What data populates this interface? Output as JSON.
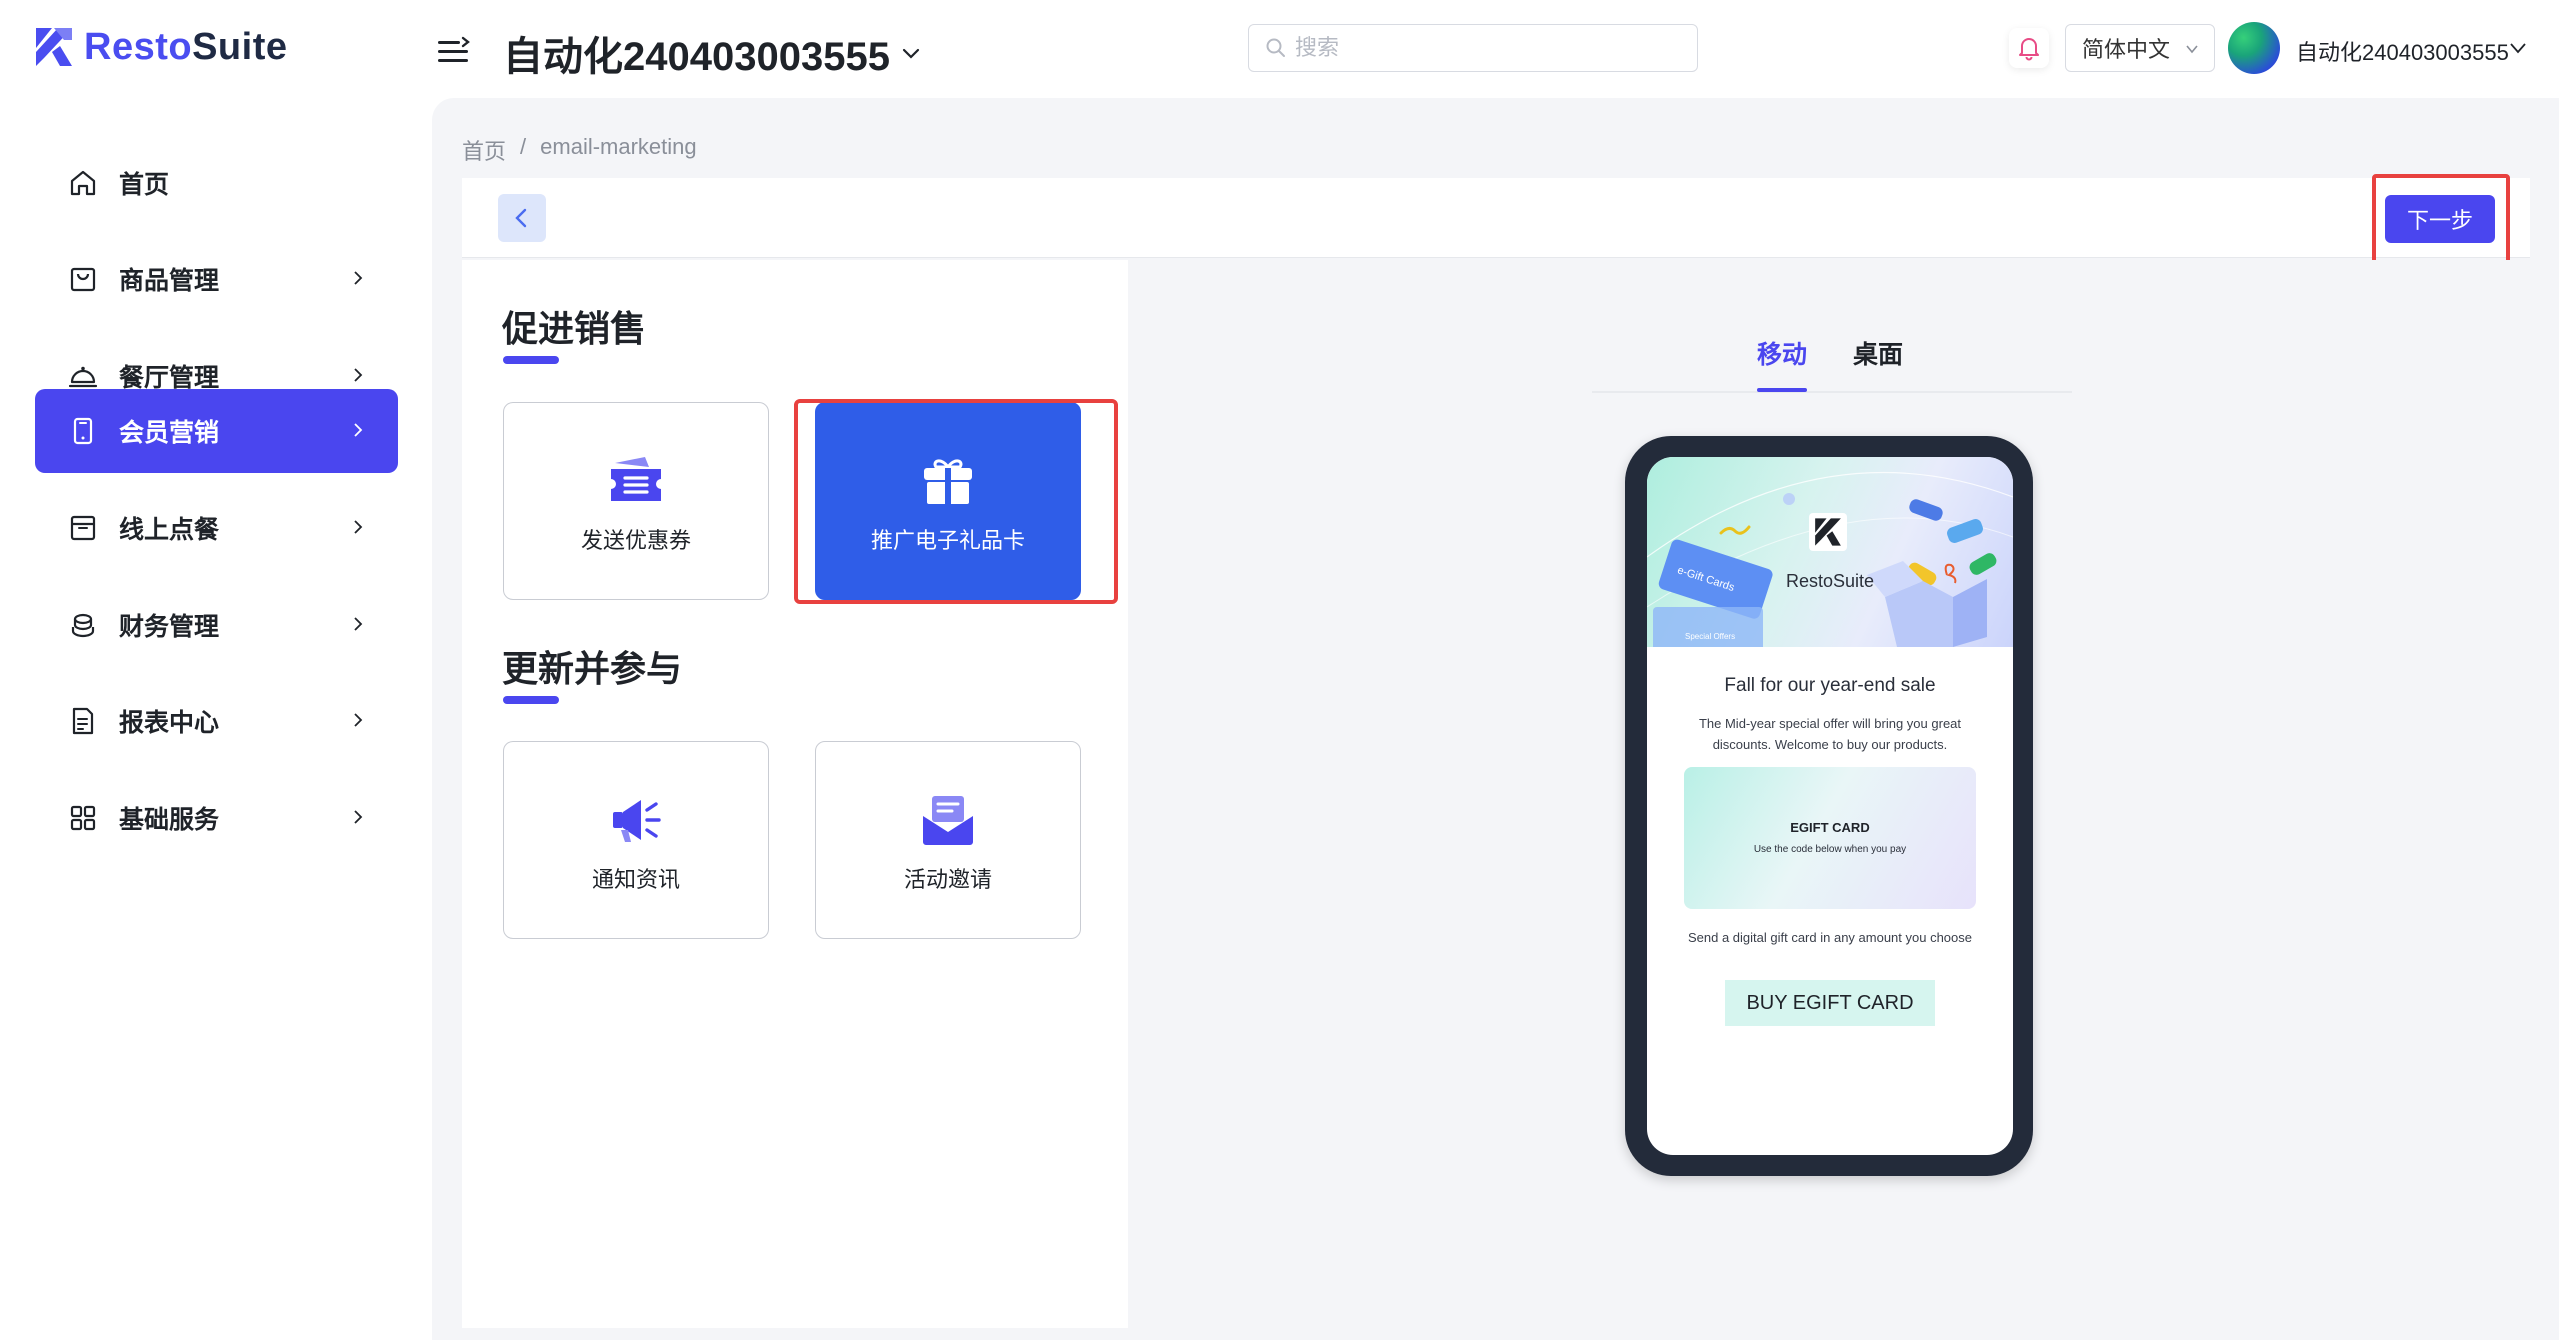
{
  "app": {
    "brand_prefix": "Resto",
    "brand_suffix": "Suite",
    "store_name": "自动化240403003555"
  },
  "header": {
    "search_placeholder": "搜索",
    "language": "简体中文",
    "user_name": "自动化240403003555"
  },
  "sidebar": {
    "items": [
      {
        "label": "首页",
        "icon": "home-icon"
      },
      {
        "label": "商品管理",
        "icon": "bag-icon"
      },
      {
        "label": "餐厅管理",
        "icon": "cloche-icon"
      },
      {
        "label": "会员营销",
        "icon": "phone-icon",
        "active": true
      },
      {
        "label": "线上点餐",
        "icon": "box-icon"
      },
      {
        "label": "财务管理",
        "icon": "coins-icon"
      },
      {
        "label": "报表中心",
        "icon": "report-icon"
      },
      {
        "label": "基础服务",
        "icon": "grid-icon"
      }
    ]
  },
  "breadcrumb": {
    "home": "首页",
    "separator": "/",
    "current": "email-marketing"
  },
  "toolbar": {
    "next_label": "下一步"
  },
  "sections": [
    {
      "title": "促进销售",
      "cards": [
        {
          "label": "发送优惠券",
          "icon": "coupon-icon",
          "selected": false
        },
        {
          "label": "推广电子礼品卡",
          "icon": "gift-icon",
          "selected": true
        }
      ]
    },
    {
      "title": "更新并参与",
      "cards": [
        {
          "label": "通知资讯",
          "icon": "megaphone-icon",
          "selected": false
        },
        {
          "label": "活动邀请",
          "icon": "envelope-icon",
          "selected": false
        }
      ]
    }
  ],
  "preview": {
    "tabs": [
      {
        "label": "移动",
        "active": true
      },
      {
        "label": "桌面",
        "active": false
      }
    ],
    "banner_brand": "RestoSuite",
    "title": "Fall for our year-end sale",
    "description": "The Mid-year special offer will bring you great discounts. Welcome to buy our products.",
    "egift_title": "EGIFT CARD",
    "egift_subtitle": "Use the code below when you pay",
    "send_text": "Send a digital gift card in any amount you choose",
    "button_label": "BUY EGIFT CARD",
    "banner_card_text": "e-Gift Cards",
    "banner_card_sub": "Special Offers"
  },
  "colors": {
    "accent": "#4a46ef",
    "selected_card": "#2f5de8",
    "highlight": "#e8413f"
  }
}
